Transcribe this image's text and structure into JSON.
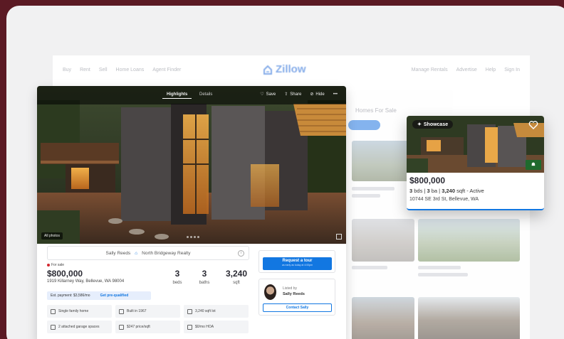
{
  "site": {
    "nav_left": [
      "Buy",
      "Rent",
      "Sell",
      "Home Loans",
      "Agent Finder"
    ],
    "nav_right": [
      "Manage Rentals",
      "Advertise",
      "Help",
      "Sign In"
    ],
    "logo_text": "Zillow",
    "list_heading": "Homes For Sale"
  },
  "listing": {
    "tabs": [
      "Highlights",
      "Details"
    ],
    "actions": {
      "save": "Save",
      "share": "Share",
      "hide": "Hide",
      "more": "•••"
    },
    "photos_badge": "All photos",
    "agent_strip": {
      "agent": "Sally Reeds",
      "brokerage": "North Bridgeway Realty"
    },
    "status": "For sale",
    "price": "$800,000",
    "address": "1919 Killarney Way, Bellevue, WA 98004",
    "beds": {
      "value": "3",
      "label": "beds"
    },
    "baths": {
      "value": "3",
      "label": "baths"
    },
    "sqft": {
      "value": "3,240",
      "label": "sqft"
    },
    "est_payment": "Est. payment: $3,586/mo",
    "pre_qualified": "Get pre-qualified",
    "facts": [
      "Single family home",
      "Built in 1967",
      "3,240 sqft lot",
      "2 attached garage spaces",
      "$247 price/sqft",
      "$0/mo HOA"
    ],
    "tour": {
      "label": "Request a tour",
      "sub": "as early as today at 4:00pm"
    },
    "agent": {
      "listed_by": "Listed by",
      "name": "Sally Reeds",
      "contact": "Contact Sally"
    }
  },
  "showcase": {
    "badge": "Showcase",
    "price": "$800,000",
    "beds": "3",
    "beds_label": "bds",
    "baths": "3",
    "baths_label": "ba",
    "sqft": "3,240",
    "sqft_label": "sqft - Active",
    "address": "10744 SE 3rd St, Bellevue, WA"
  },
  "colors": {
    "background": "#5b1a24",
    "accent": "#1277e1",
    "frame": "#f1f1f2"
  }
}
